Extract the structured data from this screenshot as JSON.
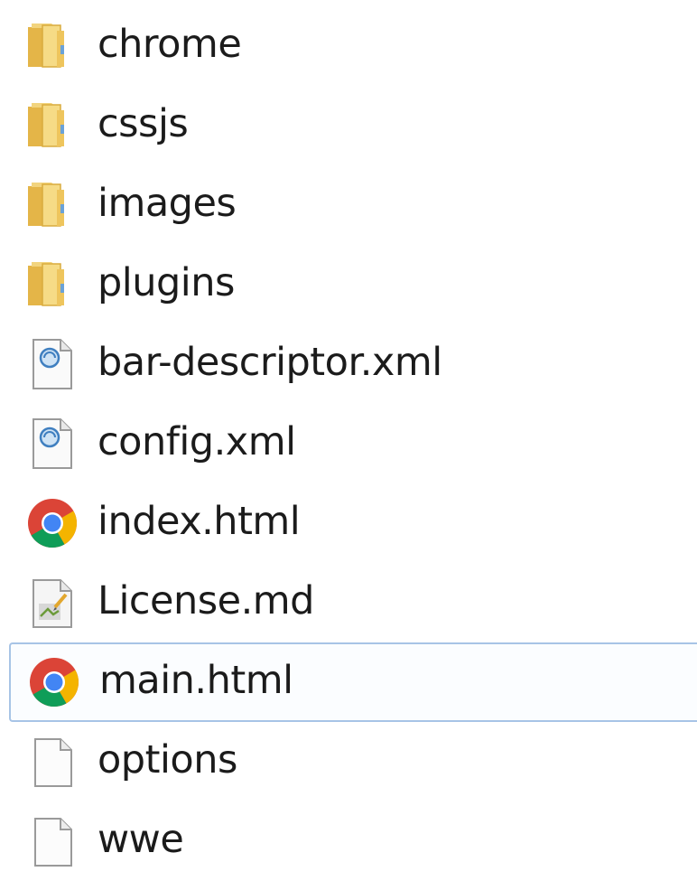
{
  "files": [
    {
      "name": "chrome",
      "icon": "folder-icon"
    },
    {
      "name": "cssjs",
      "icon": "folder-icon"
    },
    {
      "name": "images",
      "icon": "folder-icon"
    },
    {
      "name": "plugins",
      "icon": "folder-icon"
    },
    {
      "name": "bar-descriptor.xml",
      "icon": "xml-file-icon"
    },
    {
      "name": "config.xml",
      "icon": "xml-file-icon"
    },
    {
      "name": "index.html",
      "icon": "chrome-icon"
    },
    {
      "name": "License.md",
      "icon": "text-file-icon"
    },
    {
      "name": "main.html",
      "icon": "chrome-icon",
      "selected": true
    },
    {
      "name": "options",
      "icon": "blank-file-icon"
    },
    {
      "name": "wwe",
      "icon": "blank-file-icon"
    }
  ],
  "colors": {
    "selection_border": "#a7c4e6",
    "folder": "#f0c85a",
    "text": "#1b1b1b"
  }
}
